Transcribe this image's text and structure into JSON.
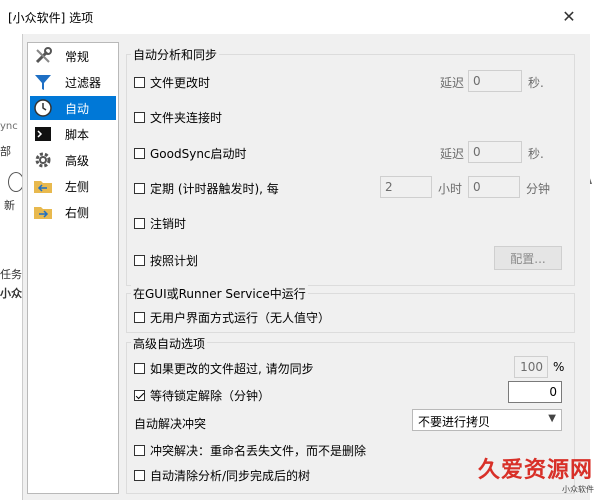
{
  "window": {
    "title": "[小众软件] 选项"
  },
  "background": {
    "fragments": [
      "部",
      "ync",
      "新",
      "任务",
      "小众",
      "选项"
    ]
  },
  "sidebar": {
    "items": [
      {
        "label": "常规",
        "icon": "wrench-screwdriver-icon",
        "selected": false
      },
      {
        "label": "过滤器",
        "icon": "funnel-icon",
        "selected": false
      },
      {
        "label": "自动",
        "icon": "clock-icon",
        "selected": true
      },
      {
        "label": "脚本",
        "icon": "console-icon",
        "selected": false
      },
      {
        "label": "高级",
        "icon": "gear-icon",
        "selected": false
      },
      {
        "label": "左侧",
        "icon": "folder-left-icon",
        "selected": false
      },
      {
        "label": "右侧",
        "icon": "folder-right-icon",
        "selected": false
      }
    ]
  },
  "auto": {
    "group_title": "自动分析和同步",
    "on_file_change": {
      "label": "文件更改时",
      "checked": false
    },
    "delay1_label": "延迟",
    "delay1_value": "0",
    "sec1_unit": "秒.",
    "on_folder_connect": {
      "label": "文件夹连接时",
      "checked": false
    },
    "on_goodsync_start": {
      "label": "GoodSync启动时",
      "checked": false
    },
    "delay2_label": "延迟",
    "delay2_value": "0",
    "sec2_unit": "秒.",
    "periodic": {
      "label": "定期 (计时器触发时), 每",
      "checked": false
    },
    "hours_value": "2",
    "hours_unit": "小时",
    "minutes_value": "0",
    "minutes_unit": "分钟",
    "on_logoff": {
      "label": "注销时",
      "checked": false
    },
    "on_schedule": {
      "label": "按照计划",
      "checked": false
    },
    "configure_button": "配置..."
  },
  "gui_runner": {
    "group_title": "在GUI或Runner Service中运行",
    "unattended": {
      "label": "无用户界面方式运行（无人值守）",
      "checked": false
    }
  },
  "advanced": {
    "group_title": "高级自动选项",
    "dont_sync_if": {
      "label": "如果更改的文件超过, 请勿同步",
      "checked": false
    },
    "percent_value": "100",
    "percent_unit": "%",
    "wait_unlock": {
      "label": "等待锁定解除（分钟）",
      "checked": true
    },
    "wait_value": "0",
    "conflict_label": "自动解决冲突",
    "conflict_select": "不要进行拷贝",
    "conflict_rename": {
      "label": "冲突解决：重命名丢失文件，而不是删除",
      "checked": false
    },
    "auto_clear": {
      "label": "自动清除分析/同步完成后的树",
      "checked": false
    }
  },
  "watermark": {
    "text": "久爱资源网",
    "small": "小众软件"
  }
}
